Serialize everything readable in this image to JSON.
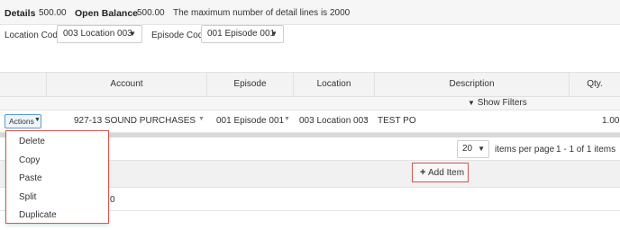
{
  "summary": {
    "details_label": "Details",
    "details_value": "500.00",
    "open_balance_label": "Open Balance",
    "open_balance_value": "500.00",
    "note": "The maximum number of detail lines is 2000"
  },
  "filters": {
    "location_label": "Location Code",
    "location_value": "003 Location 003",
    "episode_label": "Episode Code",
    "episode_value": "001 Episode 001"
  },
  "grid": {
    "columns": [
      "Account",
      "Episode",
      "Location",
      "Description",
      "Qty."
    ],
    "show_filters": "Show Filters",
    "rows": [
      {
        "actions": "Actions",
        "account": "927-13 SOUND PURCHASES",
        "episode": "001 Episode 001",
        "location": "003 Location 003",
        "description": "TEST PO",
        "qty": "1.00"
      }
    ]
  },
  "pager": {
    "page_size": "20",
    "items_per_page": "items per page",
    "range": "1 - 1 of 1 items"
  },
  "add_item_label": "Add Item",
  "footer_partial": "0",
  "actions_menu": [
    "Delete",
    "Copy",
    "Paste",
    "Split",
    "Duplicate"
  ],
  "colors": {
    "menu_border": "#d9534f",
    "actions_border": "#5b9bd5",
    "header_bg": "#f3f3f3"
  }
}
